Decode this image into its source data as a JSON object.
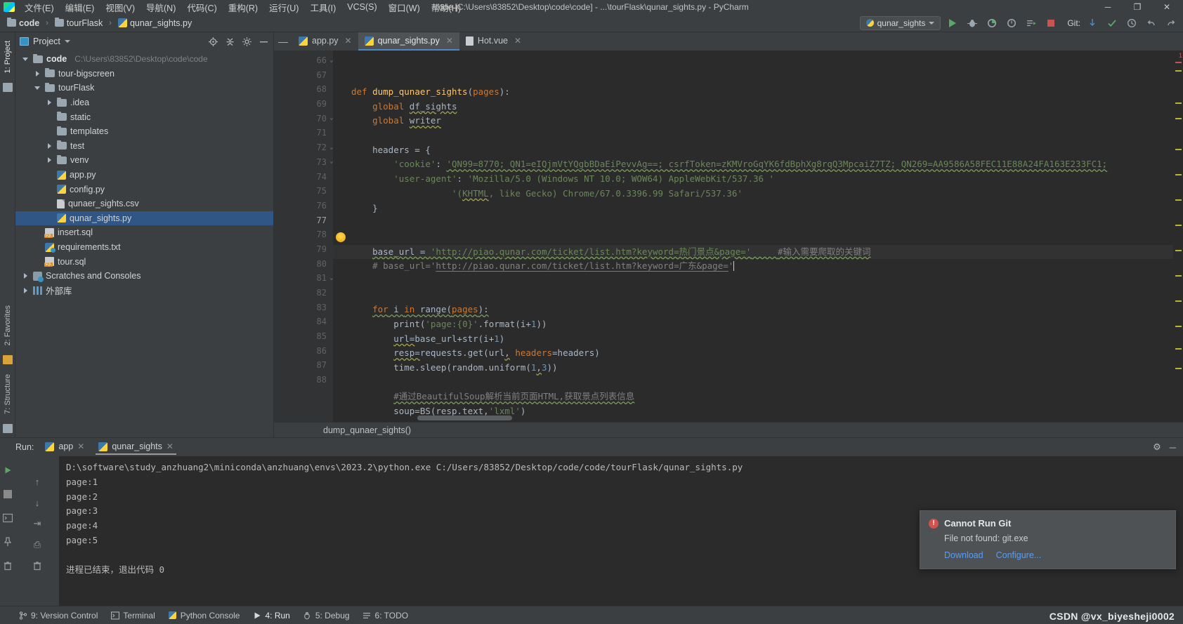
{
  "window": {
    "title": "code [C:\\Users\\83852\\Desktop\\code\\code] - ...\\tourFlask\\qunar_sights.py - PyCharm",
    "minimize": "─",
    "maximize": "❐",
    "close": "✕"
  },
  "menu": [
    "文件(E)",
    "编辑(E)",
    "视图(V)",
    "导航(N)",
    "代码(C)",
    "重构(R)",
    "运行(U)",
    "工具(I)",
    "VCS(S)",
    "窗口(W)",
    "帮助(H)"
  ],
  "breadcrumb": {
    "items": [
      "code",
      "tourFlask",
      "qunar_sights.py"
    ],
    "separator": "›"
  },
  "toolbar": {
    "run_config": "qunar_sights",
    "git_label": "Git:",
    "icons": [
      "run",
      "debug",
      "coverage",
      "profile",
      "more-run",
      "stop",
      "git-update",
      "git-commit",
      "git-push",
      "history",
      "undo",
      "redo"
    ]
  },
  "left_strip": {
    "project_tab": "1: Project",
    "favorites_tab": "2: Favorites",
    "structure_tab": "7: Structure"
  },
  "project": {
    "title": "Project",
    "toolbar_icons": [
      "locate-icon",
      "collapse-all-icon",
      "gear-icon",
      "hide-icon"
    ],
    "tree": [
      {
        "label": "code",
        "path": "C:\\Users\\83852\\Desktop\\code\\code",
        "indent": 0,
        "arrow": "open",
        "icon": "folder",
        "bold": true
      },
      {
        "label": "tour-bigscreen",
        "path": "",
        "indent": 1,
        "arrow": "closed",
        "icon": "folder",
        "bold": false
      },
      {
        "label": "tourFlask",
        "path": "",
        "indent": 1,
        "arrow": "open",
        "icon": "folder",
        "bold": false
      },
      {
        "label": ".idea",
        "path": "",
        "indent": 2,
        "arrow": "closed",
        "icon": "folder",
        "bold": false
      },
      {
        "label": "static",
        "path": "",
        "indent": 2,
        "arrow": "none",
        "icon": "folder",
        "bold": false
      },
      {
        "label": "templates",
        "path": "",
        "indent": 2,
        "arrow": "none",
        "icon": "folder",
        "bold": false
      },
      {
        "label": "test",
        "path": "",
        "indent": 2,
        "arrow": "closed",
        "icon": "folder",
        "bold": false
      },
      {
        "label": "venv",
        "path": "",
        "indent": 2,
        "arrow": "closed",
        "icon": "folder",
        "bold": false
      },
      {
        "label": "app.py",
        "path": "",
        "indent": 2,
        "arrow": "none",
        "icon": "py",
        "bold": false
      },
      {
        "label": "config.py",
        "path": "",
        "indent": 2,
        "arrow": "none",
        "icon": "py",
        "bold": false
      },
      {
        "label": "qunaer_sights.csv",
        "path": "",
        "indent": 2,
        "arrow": "none",
        "icon": "csv",
        "bold": false
      },
      {
        "label": "qunar_sights.py",
        "path": "",
        "indent": 2,
        "arrow": "none",
        "icon": "py",
        "bold": false,
        "selected": true
      },
      {
        "label": "insert.sql",
        "path": "",
        "indent": 1,
        "arrow": "none",
        "icon": "sql",
        "bold": false
      },
      {
        "label": "requirements.txt",
        "path": "",
        "indent": 1,
        "arrow": "none",
        "icon": "txt",
        "bold": false
      },
      {
        "label": "tour.sql",
        "path": "",
        "indent": 1,
        "arrow": "none",
        "icon": "sql",
        "bold": false
      },
      {
        "label": "Scratches and Consoles",
        "path": "",
        "indent": 0,
        "arrow": "closed",
        "icon": "scratch",
        "bold": false
      },
      {
        "label": "外部库",
        "path": "",
        "indent": 0,
        "arrow": "closed",
        "icon": "lib",
        "bold": false
      }
    ]
  },
  "editor": {
    "tabs": [
      {
        "label": "app.py",
        "icon": "py",
        "active": false
      },
      {
        "label": "qunar_sights.py",
        "icon": "py",
        "active": true
      },
      {
        "label": "Hot.vue",
        "icon": "vue",
        "active": false
      }
    ],
    "first_line": 66,
    "lines": [
      {
        "n": 66,
        "fold": "collapse",
        "html": "<span class=\"k\">def </span><span class=\"fn\">dump_qunaer_sights</span>(<span class=\"param\">pages</span>):"
      },
      {
        "n": 67,
        "fold": "",
        "html": "    <span class=\"k\">global</span> <span class=\"wu\">df_sights</span>"
      },
      {
        "n": 68,
        "fold": "",
        "html": "    <span class=\"k\">global</span> <span class=\"wu\">writer</span>"
      },
      {
        "n": 69,
        "fold": "",
        "html": ""
      },
      {
        "n": 70,
        "fold": "collapse",
        "html": "    headers = {"
      },
      {
        "n": 71,
        "fold": "",
        "html": "        <span class=\"s\">'cookie'</span>: <span class=\"s wug\">'QN99=8770; QN1=eIQjmVtYQgbBDaEiPevvAg==; csrfToken=zKMVroGqYK6fdBphXg8rqQ3MpcaiZ7TZ; QN269=AA9586A58FEC11E88A24FA163E233FC1;</span>"
      },
      {
        "n": 72,
        "fold": "collapse",
        "html": "        <span class=\"s\">'user-agent'</span>: <span class=\"s\">'Mozilla/5.0 (Windows NT 10.0; WOW64) AppleWebKit/537.36 '</span>"
      },
      {
        "n": 73,
        "fold": "collapse",
        "html": "                   <span class=\"s\">'(<span class=\"wu\">KHTML</span>, like Gecko) Chrome/67.0.3396.99 Safari/537.36'</span>"
      },
      {
        "n": 74,
        "fold": "",
        "html": "    }"
      },
      {
        "n": 75,
        "fold": "",
        "html": ""
      },
      {
        "n": 76,
        "fold": "",
        "html": "",
        "bulb": true
      },
      {
        "n": 77,
        "fold": "",
        "html": "    <span class=\"wug\">base_url = <span class=\"s\">'http://piao.qunar.com/ticket/list.htm?keyword=热门景点&amp;page='</span>     <span class=\"c\">#输入需要爬取的关键词</span></span>",
        "current": true
      },
      {
        "n": 78,
        "fold": "",
        "html": "    <span class=\"c\"># base_url='<span class=\"ul\">http://piao.qunar.com/ticket/list.htm?keyword=广东&amp;page=</span>'</span>",
        "caret": true
      },
      {
        "n": 79,
        "fold": "",
        "html": ""
      },
      {
        "n": 80,
        "fold": "",
        "html": ""
      },
      {
        "n": 81,
        "fold": "collapse",
        "html": "    <span class=\"k wug\">for</span><span class=\"wug\"> i </span><span class=\"k wug\">in</span><span class=\"wug\"> range(<span class=\"param\">pages</span>):</span>"
      },
      {
        "n": 82,
        "fold": "",
        "html": "        <span class=\"kw\">print</span>(<span class=\"s\">'page:{0}'</span>.format(i+<span class=\"n\">1</span>))"
      },
      {
        "n": 83,
        "fold": "",
        "html": "        <span class=\"wu\">url=</span>base_url+<span class=\"kw\">str</span>(i+<span class=\"n\">1</span>)"
      },
      {
        "n": 84,
        "fold": "",
        "html": "        <span class=\"wu\">resp=</span>requests.get(url<span class=\"wu\">,</span> <span class=\"k\">headers</span>=headers)"
      },
      {
        "n": 85,
        "fold": "",
        "html": "        time.sleep(random.uniform(<span class=\"n\">1</span><span class=\"wu\">,</span><span class=\"n\">3</span>))"
      },
      {
        "n": 86,
        "fold": "",
        "html": ""
      },
      {
        "n": 87,
        "fold": "",
        "html": "        <span class=\"c wug\">#通过BeautifulSoup解析当前页面HTML,获取景点列表信息</span>"
      },
      {
        "n": 88,
        "fold": "",
        "html": "        soup=BS(resp.text<span class=\"wu\">,</span><span class=\"s\">'lxml'</span>)"
      }
    ],
    "footer_breadcrumb": "dump_qunaer_sights()",
    "error_count": "1"
  },
  "run": {
    "label": "Run:",
    "tabs": [
      {
        "label": "app",
        "active": false
      },
      {
        "label": "qunar_sights",
        "active": true
      }
    ],
    "gear_icon": "⚙",
    "minimize_icon": "─",
    "console": [
      "D:\\software\\study_anzhuang2\\miniconda\\anzhuang\\envs\\2023.2\\python.exe C:/Users/83852/Desktop/code/code/tourFlask/qunar_sights.py",
      "page:1",
      "page:2",
      "page:3",
      "page:4",
      "page:5",
      "",
      "进程已结束，退出代码 0"
    ],
    "side_icons": [
      "run-icon",
      "stop-icon",
      "console-icon",
      "pin-icon",
      "trash-icon"
    ],
    "gutter_icons": [
      "up-arrow-icon",
      "down-arrow-icon",
      "wrap-icon",
      "filter-icon",
      "settings-icon"
    ]
  },
  "notification": {
    "title": "Cannot Run Git",
    "message": "File not found: git.exe",
    "links": [
      "Download",
      "Configure..."
    ]
  },
  "statusbar": {
    "items": [
      {
        "label": "9: Version Control",
        "icon": "branch-icon",
        "active": false
      },
      {
        "label": "Terminal",
        "icon": "terminal-icon",
        "active": false
      },
      {
        "label": "Python Console",
        "icon": "python-icon",
        "active": false
      },
      {
        "label": "4: Run",
        "icon": "run-icon",
        "active": true
      },
      {
        "label": "5: Debug",
        "icon": "debug-icon",
        "active": false
      },
      {
        "label": "6: TODO",
        "icon": "todo-icon",
        "active": false
      }
    ],
    "watermark": "CSDN @vx_biyesheji0002"
  },
  "colors": {
    "background": "#3c3f41",
    "editor_bg": "#2b2b2b",
    "accent": "#4a88c7",
    "selection": "#2f5685",
    "error": "#d0514d",
    "link": "#589df6",
    "keyword": "#cc7832",
    "string": "#6a8759",
    "function": "#ffc66d",
    "number": "#6897bb",
    "comment": "#808080"
  }
}
